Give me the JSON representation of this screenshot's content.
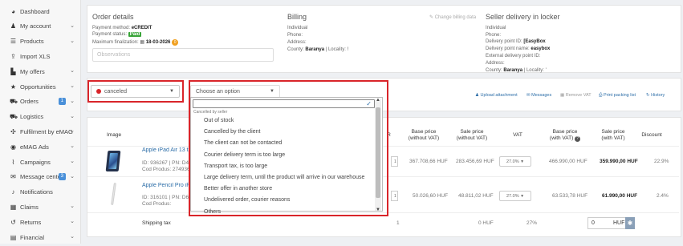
{
  "sidebar": {
    "items": [
      {
        "label": "Dashboard",
        "icon": "dashboard-icon",
        "glyph": "◕",
        "chevron": false,
        "badge": ""
      },
      {
        "label": "My account",
        "icon": "user-icon",
        "glyph": "♟",
        "chevron": true,
        "badge": ""
      },
      {
        "label": "Products",
        "icon": "list-icon",
        "glyph": "☰",
        "chevron": true,
        "badge": ""
      },
      {
        "label": "Import XLS",
        "icon": "upload-icon",
        "glyph": "⇪",
        "chevron": false,
        "badge": ""
      },
      {
        "label": "My offers",
        "icon": "chart-icon",
        "glyph": "▙",
        "chevron": true,
        "badge": ""
      },
      {
        "label": "Opportunities",
        "icon": "star-icon",
        "glyph": "★",
        "chevron": true,
        "badge": ""
      },
      {
        "label": "Orders",
        "icon": "cart-icon",
        "glyph": "⛟",
        "chevron": true,
        "badge": "1"
      },
      {
        "label": "Logistics",
        "icon": "truck-icon",
        "glyph": "⛟",
        "chevron": true,
        "badge": ""
      },
      {
        "label": "Fulfilment by eMAG",
        "icon": "handshake-icon",
        "glyph": "✣",
        "chevron": true,
        "badge": ""
      },
      {
        "label": "eMAG Ads",
        "icon": "ads-icon",
        "glyph": "◉",
        "chevron": true,
        "badge": ""
      },
      {
        "label": "Campaigns",
        "icon": "line-chart-icon",
        "glyph": "⌇",
        "chevron": true,
        "badge": ""
      },
      {
        "label": "Message center",
        "icon": "message-icon",
        "glyph": "✉",
        "chevron": true,
        "badge": "3"
      },
      {
        "label": "Notifications",
        "icon": "bell-icon",
        "glyph": "♪",
        "chevron": false,
        "badge": ""
      },
      {
        "label": "Claims",
        "icon": "claims-icon",
        "glyph": "▦",
        "chevron": true,
        "badge": ""
      },
      {
        "label": "Returns",
        "icon": "returns-icon",
        "glyph": "↺",
        "chevron": true,
        "badge": ""
      },
      {
        "label": "Financial",
        "icon": "financial-icon",
        "glyph": "▤",
        "chevron": true,
        "badge": ""
      }
    ]
  },
  "order_details": {
    "title": "Order details",
    "payment_method_label": "Payment method:",
    "payment_method": "eCREDIT",
    "payment_status_label": "Payment status:",
    "payment_status": "Paid",
    "finalization_label": "Maximum finalization:",
    "finalization_date": "18-03-2026",
    "finalization_badge": "0",
    "observations_placeholder": "Observations"
  },
  "billing": {
    "title": "Billing",
    "change_link": "Change billing data",
    "individual": "Individual",
    "phone": "Phone:",
    "address": "Address:",
    "county_label": "County:",
    "county": "Baranya",
    "locality_label": "Locality:",
    "locality": "!"
  },
  "delivery": {
    "title": "Seller delivery in locker",
    "individual": "Individual",
    "phone": "Phone:",
    "point_id_label": "Delivery point ID:",
    "point_id": "[EasyBox",
    "point_name_label": "Delivery point name:",
    "point_name": "easybox",
    "external_id": "External delivery point ID:",
    "address": "Address:",
    "county_label": "County:",
    "county": "Baranya",
    "locality_label": "Locality:",
    "locality": "'"
  },
  "status": {
    "value": "canceled",
    "color": "#d9252a"
  },
  "reason_select": {
    "placeholder": "Choose an option",
    "group_label": "Cancelled by seller",
    "options": [
      "Out of stock",
      "Cancelled by the client",
      "The client can not be contacted",
      "Courier delivery term is too large",
      "Transport tax, is too large",
      "Large delivery term, until the product will arrive in our warehouse",
      "Better offer in another store",
      "Undelivered order, courier reasons",
      "Others"
    ]
  },
  "actions": {
    "upload": "Upload attachment",
    "messages": "Messages",
    "remove_vat": "Remove VAT",
    "print": "Print packing list",
    "history": "History"
  },
  "table": {
    "headers": {
      "image": "Image",
      "base_no_vat": [
        "Base price",
        "(without VAT)"
      ],
      "sale_no_vat": [
        "Sale price",
        "(without VAT)"
      ],
      "vat": "VAT",
      "base_vat": [
        "Base price",
        "(with VAT)"
      ],
      "sale_vat": [
        "Sale price",
        "(with VAT)"
      ],
      "discount": "Discount"
    },
    "rows": [
      {
        "name": "Apple iPad Air 13 tab",
        "id_line": "ID: 936267 | PN: D4",
        "cod_line": "Cod Produs: 274936",
        "qty": "1",
        "base_no_vat": "367.708,66 HUF",
        "sale_no_vat": "283.456,69 HUF",
        "vat": "27.0%",
        "base_vat": "466.990,00 HUF",
        "sale_vat": "359.990,00 HUF",
        "discount": "22.9%"
      },
      {
        "name": "Apple Pencil Pro iPa",
        "id_line": "ID: 316101 | PN: D6",
        "cod_line": "Cod Produs:",
        "qty": "1",
        "base_no_vat": "50.026,60 HUF",
        "sale_no_vat": "48.811,02 HUF",
        "vat": "27.0%",
        "base_vat": "63.533,78 HUF",
        "sale_vat": "61.990,00 HUF",
        "discount": "2.4%"
      }
    ],
    "shipping": {
      "label": "Shipping tax",
      "qty": "1",
      "price": "0 HUF",
      "vat": "27%",
      "value": "0",
      "currency": "HUF"
    }
  }
}
